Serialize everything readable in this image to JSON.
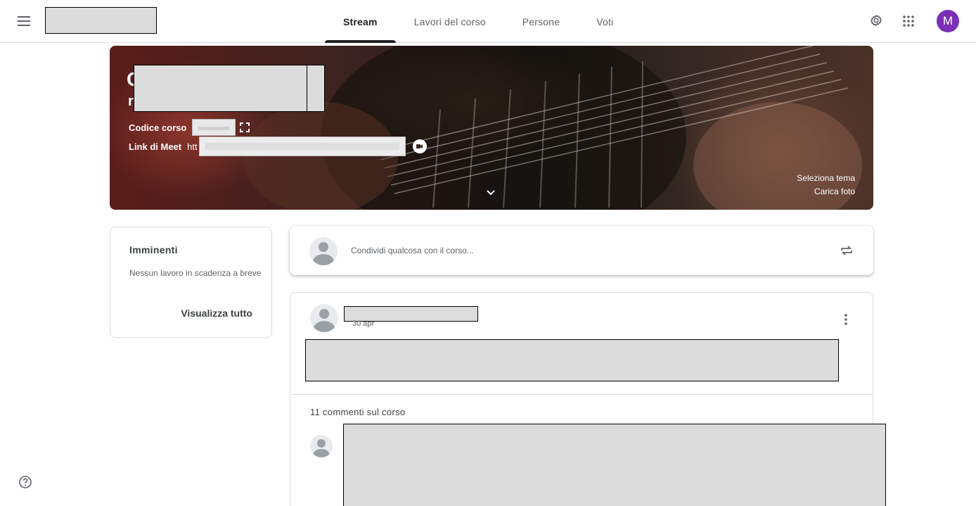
{
  "header": {
    "tabs": [
      {
        "label": "Stream",
        "active": true
      },
      {
        "label": "Lavori del corso",
        "active": false
      },
      {
        "label": "Persone",
        "active": false
      },
      {
        "label": "Voti",
        "active": false
      }
    ],
    "account_initial": "M",
    "account_color": "#7b2fb5"
  },
  "banner": {
    "title_fragment_1": "C",
    "title_fragment_2": "r",
    "course_code_label": "Codice corso",
    "meet_link_label": "Link di Meet",
    "meet_link_fragment": "htt",
    "select_theme": "Seleziona tema",
    "upload_photo": "Carica foto"
  },
  "upcoming": {
    "title": "Imminenti",
    "message": "Nessun lavoro in scadenza a breve",
    "view_all": "Visualizza tutto"
  },
  "share": {
    "placeholder": "Condividi qualcosa con il corso..."
  },
  "post": {
    "date": "30 apr",
    "comments": "11 commenti sul corso"
  },
  "icons": {
    "menu": "hamburger-menu-icon",
    "settings": "gear-icon",
    "apps": "apps-grid-icon",
    "help": "help-circle-icon"
  }
}
